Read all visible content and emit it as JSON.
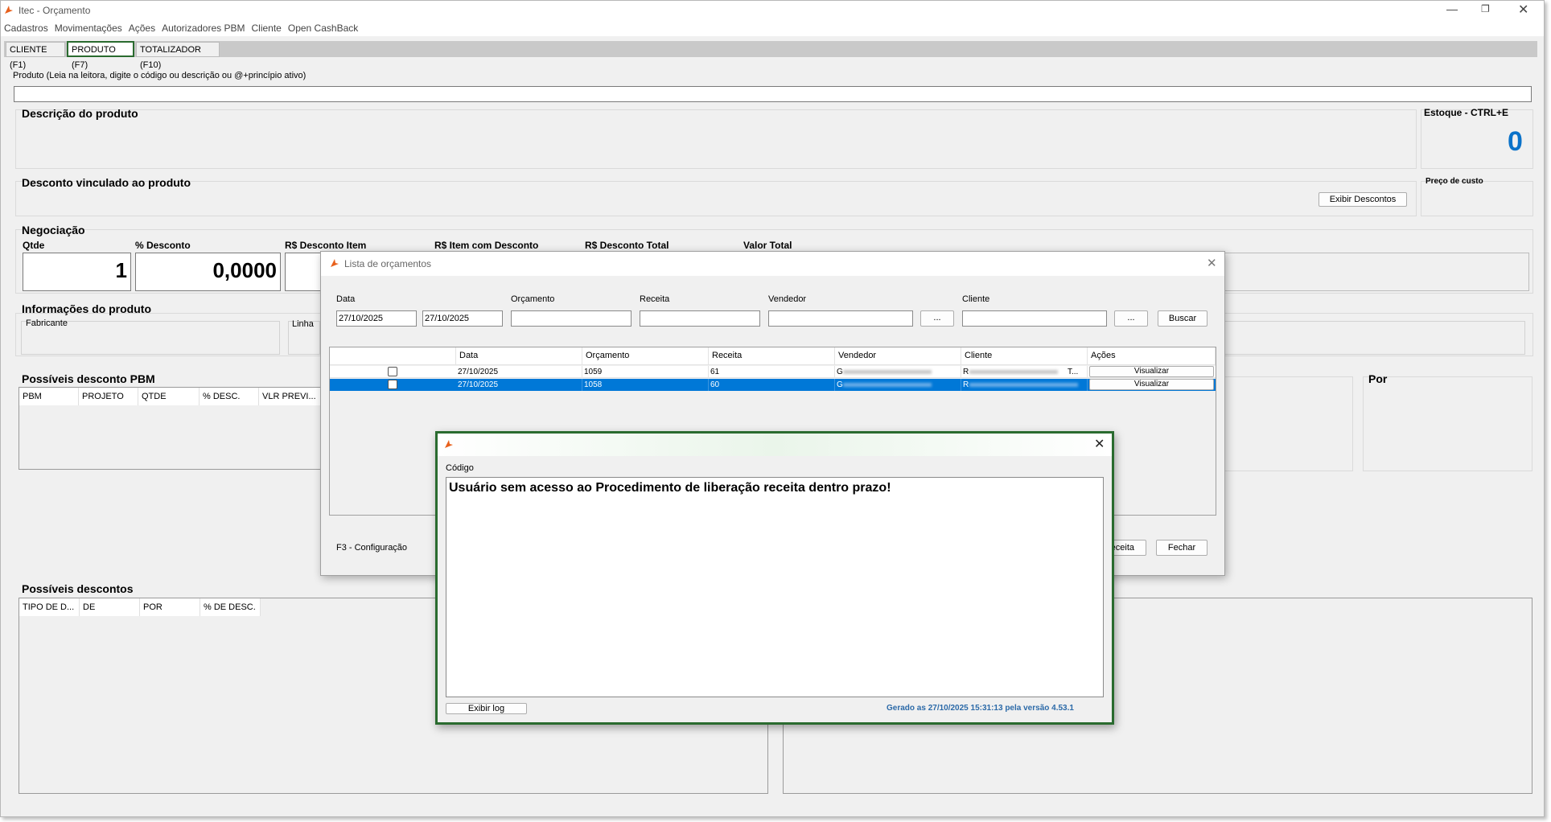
{
  "app": {
    "title": "Itec - Orçamento"
  },
  "menu": [
    "Cadastros",
    "Movimentações",
    "Ações",
    "Autorizadores PBM",
    "Cliente",
    "Open CashBack"
  ],
  "tabs": [
    "CLIENTE (F1)",
    "PRODUTO (F7)",
    "TOTALIZADOR (F10)"
  ],
  "product": {
    "search_label": "Produto (Leia na leitora, digite o código ou descrição ou @+princípio ativo)",
    "search_value": ""
  },
  "sections": {
    "description": "Descrição do produto",
    "stock_title": "Estoque - CTRL+E",
    "stock_value": "0",
    "discount_linked": "Desconto vinculado ao produto",
    "cost_price": "Preço de custo",
    "show_discounts": "Exibir Descontos",
    "negotiation": "Negociação",
    "product_info": "Informações do produto",
    "pbm_discounts": "Possíveis desconto PBM",
    "possible_discounts": "Possíveis descontos",
    "por": "Por"
  },
  "negotiation": {
    "qty_label": "Qtde",
    "qty_value": "1",
    "discount_label": "% Desconto",
    "discount_value": "0,0000",
    "item_discount_label": "R$ Desconto Item",
    "item_with_discount_label": "R$ Item com Desconto",
    "total_discount_label": "R$ Desconto Total",
    "total_value_label": "Valor Total"
  },
  "info": {
    "manufacturer": "Fabricante",
    "line": "Linha"
  },
  "pbm_columns": [
    "PBM",
    "PROJETO",
    "QTDE",
    "% DESC.",
    "VLR PREVI..."
  ],
  "discount_columns": [
    "TIPO DE D...",
    "DE",
    "POR",
    "% DE DESC."
  ],
  "budget_dialog": {
    "title": "Lista de orçamentos",
    "labels": {
      "date": "Data",
      "budget": "Orçamento",
      "prescription": "Receita",
      "seller": "Vendedor",
      "client": "Cliente"
    },
    "date_from": "27/10/2025",
    "date_to": "27/10/2025",
    "ellipsis": "...",
    "search_button": "Buscar",
    "columns": [
      "Data",
      "Orçamento",
      "Receita",
      "Vendedor",
      "Cliente",
      "Ações"
    ],
    "rows": [
      {
        "date": "27/10/2025",
        "budget": "1059",
        "prescription": "61",
        "seller": "G",
        "client": "R",
        "client_suffix": "T...",
        "action": "Visualizar"
      },
      {
        "date": "27/10/2025",
        "budget": "1058",
        "prescription": "60",
        "seller": "G",
        "client": "R",
        "client_suffix": "",
        "action": "Visualizar"
      }
    ],
    "footer_hint": "F3 - Configuração",
    "prescription_button": "eceita",
    "close_button": "Fechar"
  },
  "error_dialog": {
    "code_label": "Código",
    "message": "Usuário sem acesso ao Procedimento de liberação receita dentro prazo!",
    "log_button": "Exibir log",
    "generated": "Gerado as 27/10/2025 15:31:13 pela versão 4.53.1"
  },
  "colors": {
    "accent": "#0a72c9",
    "selection": "#0078d7",
    "highlight_border": "#2a6b2f",
    "version_text": "#2c6aa8"
  }
}
